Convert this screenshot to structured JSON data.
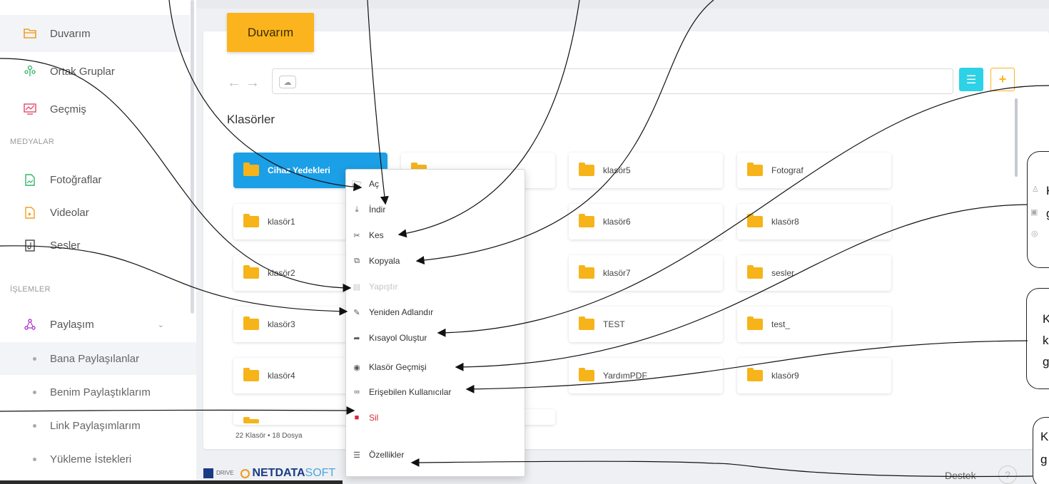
{
  "sidebar": {
    "items": [
      {
        "label": "Duvarım",
        "icon": "folder-open-icon"
      },
      {
        "label": "Ortak Gruplar",
        "icon": "group-icon"
      },
      {
        "label": "Geçmiş",
        "icon": "history-chart-icon"
      }
    ],
    "media_section": "MEDYALAR",
    "media_items": [
      {
        "label": "Fotoğraflar",
        "icon": "photo-file-icon"
      },
      {
        "label": "Videolar",
        "icon": "video-file-icon"
      },
      {
        "label": "Sesler",
        "icon": "audio-file-icon"
      }
    ],
    "ops_section": "İŞLEMLER",
    "share_label": "Paylaşım",
    "share_sub": [
      "Bana Paylaşılanlar",
      "Benim Paylaştıklarım",
      "Link Paylaşımlarım",
      "Yükleme İstekleri"
    ]
  },
  "header": {
    "tab_title": "Duvarım",
    "nav_back": "←",
    "nav_forward": "→"
  },
  "main": {
    "section_title": "Klasörler",
    "folders": [
      "Cihaz Yedekleri",
      "klasör5",
      "Fotograf",
      "klasör1",
      "klasör6",
      "klasör8",
      "klasör2",
      "klasör7",
      "sesler",
      "klasör3",
      "TEST",
      "test_",
      "klasör4",
      "YardımPDF",
      "klasör9"
    ],
    "footer_count": "22 Klasör • 18 Dosya"
  },
  "context_menu": [
    {
      "label": "Aç",
      "icon": "folder-open-icon",
      "state": "normal"
    },
    {
      "label": "İndir",
      "icon": "download-icon",
      "state": "normal"
    },
    {
      "label": "Kes",
      "icon": "scissors-icon",
      "state": "normal"
    },
    {
      "label": "Kopyala",
      "icon": "copy-icon",
      "state": "normal"
    },
    {
      "label": "Yapıştır",
      "icon": "paste-icon",
      "state": "disabled"
    },
    {
      "label": "Yeniden Adlandır",
      "icon": "edit-icon",
      "state": "normal"
    },
    {
      "label": "Kısayol Oluştur",
      "icon": "share-arrow-icon",
      "state": "normal"
    },
    {
      "label": "Klasör Geçmişi",
      "icon": "eye-icon",
      "state": "normal"
    },
    {
      "label": "Erişebilen Kullanıcılar",
      "icon": "binoculars-icon",
      "state": "normal"
    },
    {
      "label": "Sil",
      "icon": "trash-icon",
      "state": "danger"
    },
    {
      "label": "Özellikler",
      "icon": "list-icon",
      "state": "normal"
    }
  ],
  "footer": {
    "brand_net": "NETDATA",
    "brand_soft": "SOFT",
    "brand_mini": "DRIVE",
    "support": "Destek",
    "help": "?"
  },
  "callouts": [
    {
      "lines": [
        "K",
        "g"
      ]
    },
    {
      "lines": [
        "K",
        "k",
        "g"
      ]
    },
    {
      "lines": [
        "K",
        "g"
      ]
    }
  ],
  "colors": {
    "accent": "#fbb41d",
    "selected": "#1b9fe6",
    "list_button": "#2dd2e6",
    "danger": "#d9263a"
  }
}
